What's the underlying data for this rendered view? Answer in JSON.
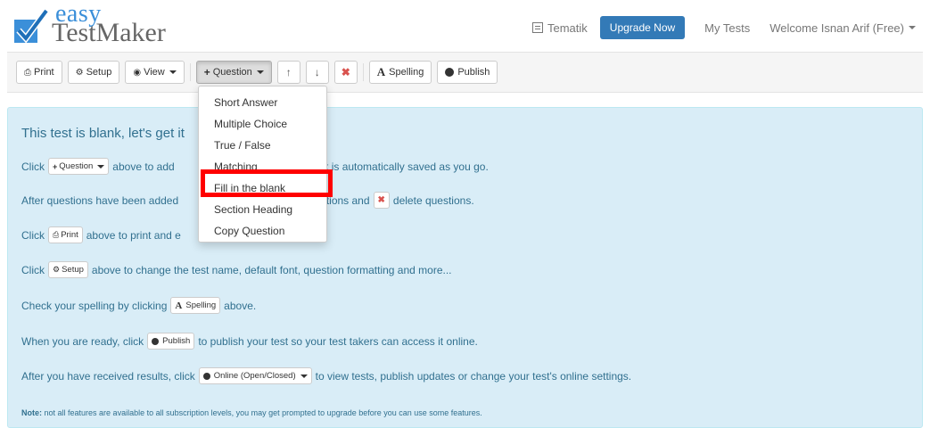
{
  "header": {
    "logo_small": "easy",
    "logo_large": "TestMaker",
    "nav": {
      "tematik": "Tematik",
      "upgrade": "Upgrade Now",
      "my_tests": "My Tests",
      "welcome": "Welcome Isnan Arif (Free)"
    }
  },
  "toolbar": {
    "print": "Print",
    "setup": "Setup",
    "view": "View",
    "question": "Question",
    "spelling": "Spelling",
    "publish": "Publish"
  },
  "menu": {
    "items": [
      "Short Answer",
      "Multiple Choice",
      "True / False",
      "Matching",
      "Fill in the blank",
      "Section Heading",
      "Copy Question"
    ]
  },
  "panel": {
    "title": "This test is blank, let's get it",
    "l1": {
      "a": "Click",
      "btn": "Question",
      "b": "above to add",
      "c": "r work is automatically saved as you go."
    },
    "l2": {
      "a": "After questions have been added",
      "b": "estions and",
      "c": "delete questions."
    },
    "l3": {
      "a": "Click",
      "btn": "Print",
      "b": "above to print and e"
    },
    "l4": {
      "a": "Click",
      "btn": "Setup",
      "b": "above to change the test name, default font, question formatting and more..."
    },
    "l5": {
      "a": "Check your spelling by clicking",
      "btn": "Spelling",
      "b": "above."
    },
    "l6": {
      "a": "When you are ready, click",
      "btn": "Publish",
      "b": "to publish your test so your test takers can access it online."
    },
    "l7": {
      "a": "After you have received results, click",
      "btn": "Online (Open/Closed)",
      "b": "to view tests, publish updates or change your test's online settings."
    },
    "note_label": "Note:",
    "note_text": "not all features are available to all subscription levels, you may get prompted to upgrade before you can use some features."
  },
  "colors": {
    "accent": "#337ab7",
    "panel_bg": "#d9edf7",
    "panel_text": "#31708f",
    "highlight": "#ff0000",
    "delete": "#d9534f"
  }
}
